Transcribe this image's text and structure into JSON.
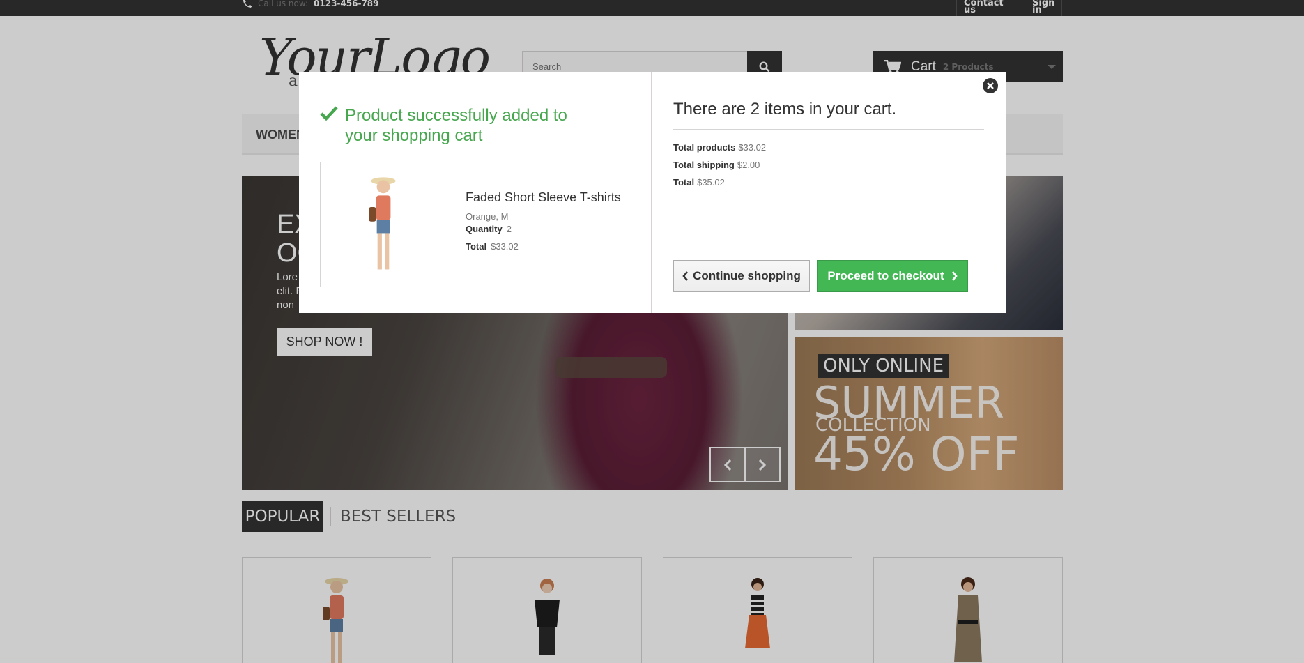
{
  "topbar": {
    "phone_label": "Call us now:",
    "phone_number": "0123-456-789",
    "contact": "Contact us",
    "signin": "Sign in"
  },
  "header": {
    "logo_text": "YourLogo",
    "logo_sub": "a",
    "search_placeholder": "Search",
    "cart_label": "Cart",
    "cart_count": "2 Products"
  },
  "menu": {
    "first_item": "WOMEN"
  },
  "slider": {
    "heading_line1": "EX",
    "heading_line2": "OC",
    "para_line1": "Lore",
    "para_line2": "elit. P",
    "para_line3": "non",
    "shop_label": "SHOP NOW !"
  },
  "banner": {
    "only_online": "ONLY ONLINE",
    "summer": "SUMMER",
    "collection": "COLLECTION",
    "off": "45% OFF"
  },
  "tabs": {
    "popular": "POPULAR",
    "best_sellers": "BEST SELLERS"
  },
  "modal": {
    "success": "Product successfully added to your shopping cart",
    "product_name": "Faded Short Sleeve T-shirts",
    "attributes": "Orange, M",
    "quantity_label": "Quantity",
    "quantity": "2",
    "total_label": "Total",
    "total": "$33.02",
    "cart_title": "There are 2 items in your cart.",
    "total_products_label": "Total products",
    "total_products": "$33.02",
    "total_shipping_label": "Total shipping",
    "total_shipping": "$2.00",
    "grand_total_label": "Total",
    "grand_total": "$35.02",
    "continue_label": "Continue shopping",
    "checkout_label": "Proceed to checkout"
  },
  "icons": [
    "phone-icon",
    "search-icon",
    "cart-icon",
    "check-icon",
    "close-icon",
    "chevron-left-icon",
    "chevron-right-icon"
  ],
  "colors": {
    "success_green": "#46a74e",
    "checkout_green": "#43b754",
    "dark": "#333333"
  }
}
